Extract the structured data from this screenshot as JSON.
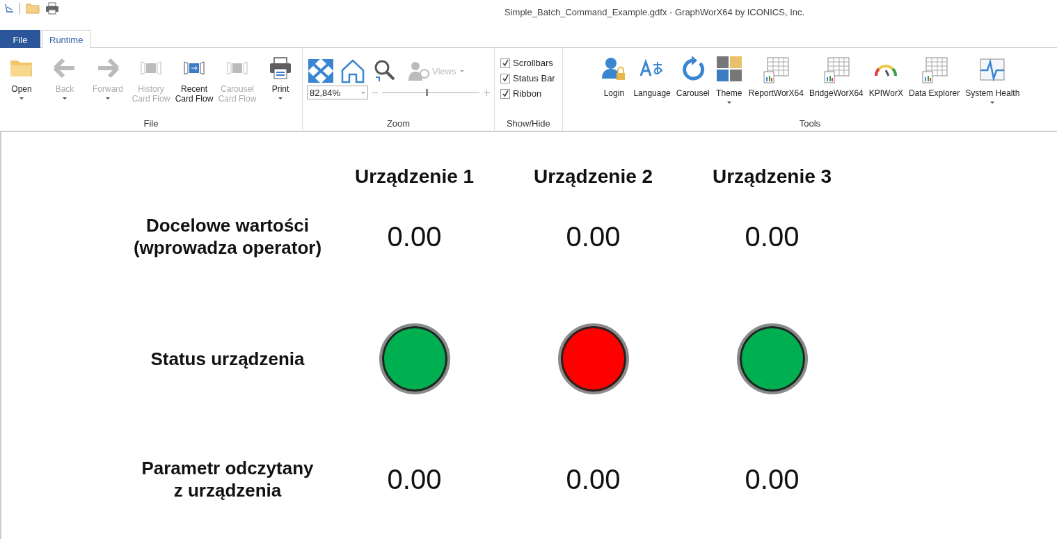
{
  "window": {
    "title": "Simple_Batch_Command_Example.gdfx - GraphWorX64 by ICONICS, Inc."
  },
  "tabs": [
    {
      "label": "File",
      "kind": "backstage",
      "selected": false
    },
    {
      "label": "Runtime",
      "kind": "ribbon",
      "selected": true
    }
  ],
  "ribbon": {
    "file_group": {
      "label": "File",
      "buttons": [
        {
          "label": "Open",
          "disabled": false,
          "dropdown": true
        },
        {
          "label": "Back",
          "disabled": true,
          "dropdown": true
        },
        {
          "label": "Forward",
          "disabled": true,
          "dropdown": true
        },
        {
          "label": "History Card Flow",
          "disabled": true,
          "dropdown": false
        },
        {
          "label": "Recent Card Flow",
          "disabled": false,
          "dropdown": false
        },
        {
          "label": "Carousel Card Flow",
          "disabled": true,
          "dropdown": false
        },
        {
          "label": "Print",
          "disabled": false,
          "dropdown": true
        }
      ]
    },
    "zoom_group": {
      "label": "Zoom",
      "zoom_value": "82,84%",
      "views_label": "Views",
      "views_disabled": true,
      "slider": {
        "level": 0.46
      }
    },
    "show_hide_group": {
      "label": "Show/Hide",
      "checkboxes": [
        {
          "label": "Scrollbars",
          "checked": true
        },
        {
          "label": "Status Bar",
          "checked": true
        },
        {
          "label": "Ribbon",
          "checked": true
        }
      ]
    },
    "tools_group": {
      "label": "Tools",
      "buttons": [
        {
          "label": "Login",
          "dropdown": false
        },
        {
          "label": "Language",
          "dropdown": false
        },
        {
          "label": "Carousel",
          "dropdown": false
        },
        {
          "label": "Theme",
          "dropdown": true
        },
        {
          "label": "ReportWorX64",
          "dropdown": false
        },
        {
          "label": "BridgeWorX64",
          "dropdown": false
        },
        {
          "label": "KPIWorX",
          "dropdown": false
        },
        {
          "label": "Data Explorer",
          "dropdown": false
        },
        {
          "label": "System Health",
          "dropdown": true
        }
      ]
    }
  },
  "display": {
    "devices": [
      "Urządzenie 1",
      "Urządzenie 2",
      "Urządzenie 3"
    ],
    "rows": [
      {
        "label": "Docelowe wartości\n(wprowadza operator)",
        "kind": "value",
        "values": [
          "0.00",
          "0.00",
          "0.00"
        ]
      },
      {
        "label": "Status urządzenia",
        "kind": "status",
        "lamps": [
          {
            "color": "#00b050"
          },
          {
            "color": "#ff0000"
          },
          {
            "color": "#00b050"
          }
        ]
      },
      {
        "label": "Parametr odczytany\nz urządzenia",
        "kind": "value",
        "values": [
          "0.00",
          "0.00",
          "0.00"
        ]
      }
    ]
  }
}
